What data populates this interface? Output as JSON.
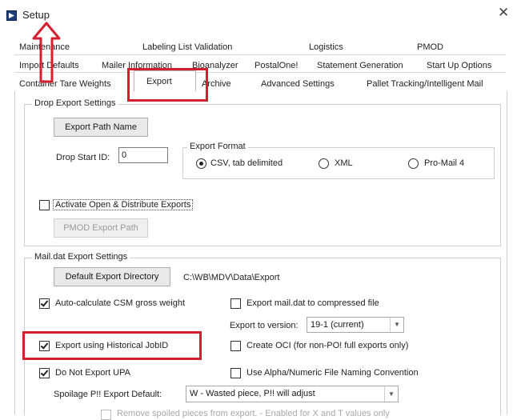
{
  "window": {
    "title": "Setup",
    "close_label": "✕"
  },
  "tabs": {
    "row1": [
      "Maintenance",
      "Labeling List Validation",
      "Logistics",
      "PMOD"
    ],
    "row2": [
      "Import Defaults",
      "Mailer Information",
      "Bioanalyzer",
      "PostalOne!",
      "Statement Generation",
      "Start Up Options"
    ],
    "row3": [
      "Container Tare Weights",
      "Export",
      "Archive",
      "Advanced Settings",
      "Pallet Tracking/Intelligent Mail"
    ],
    "selected": "Export"
  },
  "drop_export": {
    "group_label": "Drop Export Settings",
    "export_path_button": "Export Path Name",
    "drop_start_label": "Drop Start ID:",
    "drop_start_value": "0",
    "export_format_label": "Export Format",
    "formats": [
      {
        "label": "CSV, tab delimited",
        "selected": true
      },
      {
        "label": "XML",
        "selected": false
      },
      {
        "label": "Pro-Mail 4",
        "selected": false
      }
    ],
    "activate_label": "Activate Open & Distribute Exports",
    "activate_checked": false,
    "pmod_path_button": "PMOD Export Path"
  },
  "maildat_export": {
    "group_label": "Mail.dat Export Settings",
    "default_dir_button": "Default Export Directory",
    "default_dir_value": "C:\\WB\\MDV\\Data\\Export",
    "auto_calc_label": "Auto-calculate CSM gross weight",
    "auto_calc_checked": true,
    "compressed_label": "Export mail.dat to compressed file",
    "compressed_checked": false,
    "export_version_label": "Export to version:",
    "export_version_value": "19-1 (current)",
    "historical_label": "Export using Historical JobID",
    "historical_checked": true,
    "oci_label": "Create OCI (for non-PO! full exports only)",
    "oci_checked": false,
    "no_upa_label": "Do Not Export UPA",
    "no_upa_checked": true,
    "alnum_label": "Use Alpha/Numeric File Naming Convention",
    "alnum_checked": false,
    "spoilage_label": "Spoilage P!! Export Default:",
    "spoilage_value": "W - Wasted piece, P!! will adjust",
    "remove_spoiled_label": "Remove spoiled pieces from export. - Enabled for X and T values only"
  },
  "colors": {
    "highlight": "#d3202f",
    "panel_border": "#cfcfcf"
  },
  "icons": [
    "setup-app-icon",
    "close-icon",
    "up-arrow-annotation",
    "chevron-down-icon"
  ]
}
